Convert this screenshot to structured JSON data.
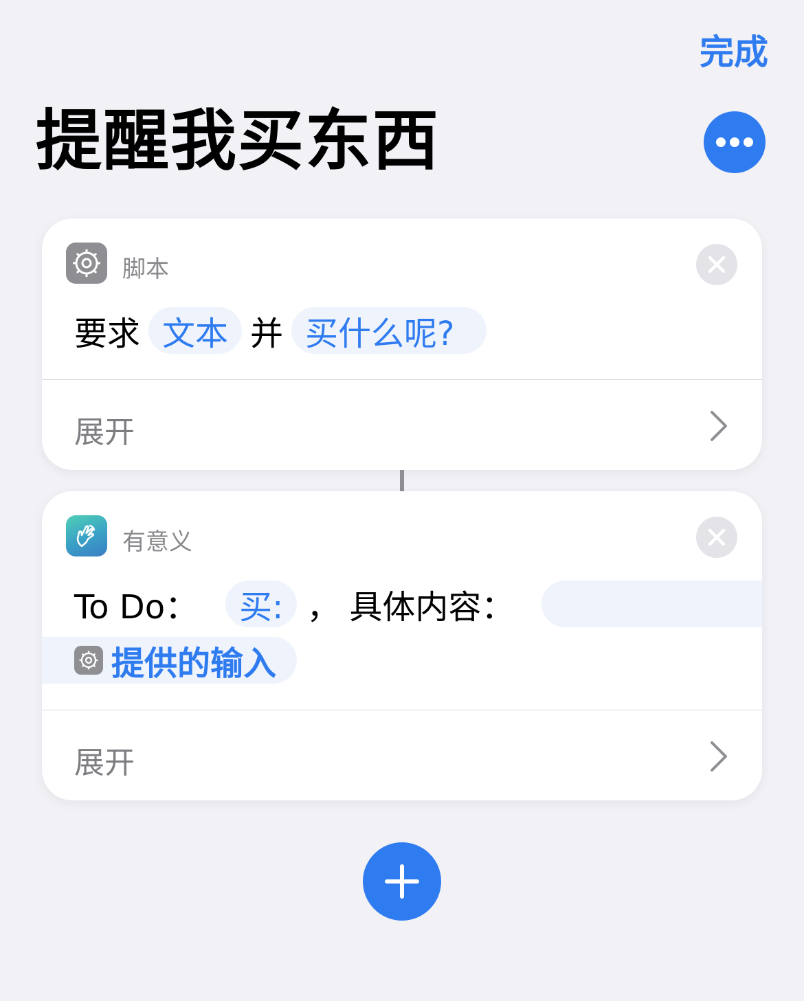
{
  "header": {
    "done_label": "完成",
    "title": "提醒我买东西"
  },
  "actions": [
    {
      "app_name": "脚本",
      "app_icon": "gear-icon",
      "text_before": "要求",
      "token1": "文本",
      "text_between": "并",
      "token2": "买什么呢?",
      "expand_label": "展开"
    },
    {
      "app_name": "有意义",
      "app_icon": "hand-icon",
      "label_todo": "To Do：",
      "token_buy": "买:",
      "sep": "，",
      "label_detail": "具体内容：",
      "token_input": "提供的输入",
      "expand_label": "展开"
    }
  ],
  "icons": {
    "more": "ellipsis-icon",
    "close": "close-icon",
    "expand": "chevron-right-icon",
    "add": "plus-icon"
  },
  "colors": {
    "accent": "#2f7bf0",
    "background": "#f1f1f6",
    "card": "#ffffff",
    "token_bg": "#eef3fc",
    "secondary_text": "#8a8a8e"
  }
}
